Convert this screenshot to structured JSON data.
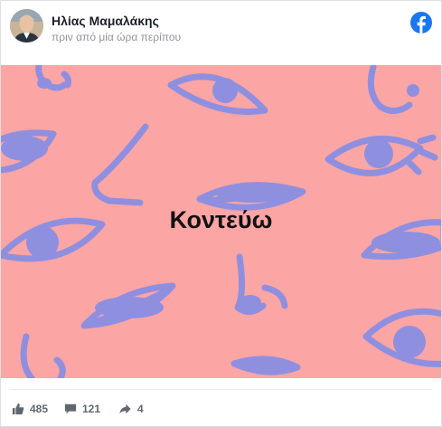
{
  "post": {
    "author": "Ηλίας Μαμαλάκης",
    "timestamp": "πριν από μία ώρα περίπου",
    "image_text": "Κοντεύω",
    "logo": "facebook-icon",
    "colors": {
      "image_bg": "#fca5a5",
      "doodle": "#8f8fe0",
      "brand": "#1877f2"
    }
  },
  "stats": {
    "likes": "485",
    "comments": "121",
    "shares": "4"
  }
}
